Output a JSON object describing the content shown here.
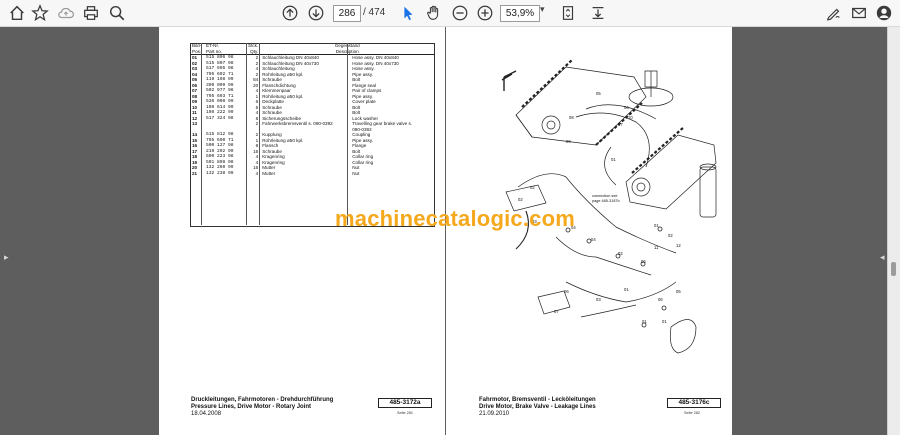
{
  "toolbar": {
    "page_current": "286",
    "page_total": "/ 474",
    "zoom": "53,9%",
    "zoom_caret": "▾"
  },
  "left_page": {
    "headers": {
      "pos": "Bild-\nPos.",
      "part": "ET-Nr.\nPart no.",
      "qty": "Stck.\nQty.",
      "de": "Gegenstand",
      "en": "Description"
    },
    "rows": [
      {
        "pos": "01",
        "part": "515 806 98",
        "qty": "2",
        "de": "Schlauchleitung DN 40x840",
        "en": "Hose assy. DN 40x840"
      },
      {
        "pos": "02",
        "part": "515 807 98",
        "qty": "2",
        "de": "Schlauchleitung DN 40x730",
        "en": "Hose assy. DN 40x730"
      },
      {
        "pos": "03",
        "part": "517 695 98",
        "qty": "4",
        "de": "Schlauchleitung",
        "en": "Hose assy."
      },
      {
        "pos": "04",
        "part": "795 692 71",
        "qty": "2",
        "de": "Rohrleitung ø50 kpl.",
        "en": "Pipe assy."
      },
      {
        "pos": "05",
        "part": "119 198 99",
        "qty": "84",
        "de": "Schraube",
        "en": "Bolt"
      },
      {
        "pos": "06",
        "part": "390 009 99",
        "qty": "20",
        "de": "Flanschdichtung",
        "en": "Flange seal"
      },
      {
        "pos": "07",
        "part": "502 977 98",
        "qty": "4",
        "de": "Klemmenpaar",
        "en": "Pair of clamps"
      },
      {
        "pos": "08",
        "part": "795 693 71",
        "qty": "1",
        "de": "Rohrleitung ø50 kpl.",
        "en": "Pipe assy."
      },
      {
        "pos": "09",
        "part": "536 008 99",
        "qty": "6",
        "de": "Deckplatte",
        "en": "Cover plate"
      },
      {
        "pos": "10",
        "part": "108 614 99",
        "qty": "6",
        "de": "Schraube",
        "en": "Bolt"
      },
      {
        "pos": "11",
        "part": "108 222 99",
        "qty": "4",
        "de": "Schraube",
        "en": "Bolt"
      },
      {
        "pos": "12",
        "part": "517 324 98",
        "qty": "8",
        "de": "Sicherungsscheibe",
        "en": "Lock washer"
      },
      {
        "pos": "13",
        "part": "",
        "qty": "2",
        "de": "Fahrwerksbremsventil s. 090-0392",
        "en": "Travelling gear brake valve s."
      },
      {
        "pos": "",
        "part": "",
        "qty": "",
        "de": "",
        "en": "090-0392"
      },
      {
        "pos": "14",
        "part": "515 812 98",
        "qty": "2",
        "de": "Kupplung",
        "en": "Coupling"
      },
      {
        "pos": "15",
        "part": "795 690 71",
        "qty": "1",
        "de": "Rohrleitung ø50 kpl.",
        "en": "Pipe assy."
      },
      {
        "pos": "16",
        "part": "500 127 98",
        "qty": "8",
        "de": "Flansch",
        "en": "Flange"
      },
      {
        "pos": "17",
        "part": "219 292 99",
        "qty": "16",
        "de": "Schraube",
        "en": "Bolt"
      },
      {
        "pos": "18",
        "part": "500 223 98",
        "qty": "4",
        "de": "Kragenring",
        "en": "Collar ring"
      },
      {
        "pos": "19",
        "part": "501 898 98",
        "qty": "4",
        "de": "Kragenring",
        "en": "Collar ring"
      },
      {
        "pos": "20",
        "part": "132 260 99",
        "qty": "16",
        "de": "Mutter",
        "en": "Nut"
      },
      {
        "pos": "21",
        "part": "132 238 99",
        "qty": "4",
        "de": "Mutter",
        "en": "Nut"
      }
    ],
    "title_de": "Druckleitungen, Fahrmotoren - Drehdurchführung",
    "title_en": "Pressure Lines, Drive Motor - Rotary Joint",
    "date": "18.04.2008",
    "code": "485-3172a",
    "page_label": "Seite 281"
  },
  "right_page": {
    "title_de": "Fahrmotor, Bremsventil - Lecköleitungen",
    "title_en": "Drive Motor, Brake Valve - Leakage Lines",
    "date": "21.09.2010",
    "code": "485-3176c",
    "page_label": "Seite 282",
    "note": "connection see\npage 485-3187b",
    "callouts": [
      "08",
      "09",
      "05",
      "06",
      "07",
      "10",
      "01",
      "02",
      "02",
      "03",
      "04",
      "04",
      "02",
      "06",
      "11",
      "12",
      "01",
      "05",
      "06",
      "01",
      "01",
      "06",
      "07",
      "02",
      "01",
      "03"
    ]
  },
  "watermark": "machinecatalogic.com"
}
